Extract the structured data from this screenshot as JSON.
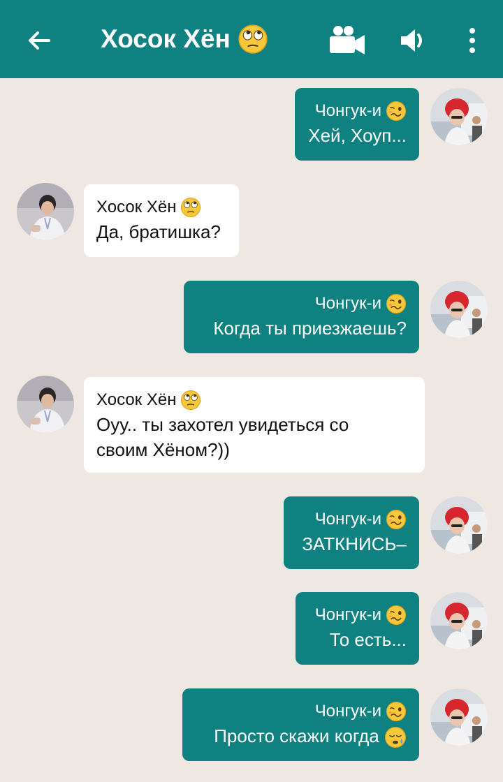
{
  "header": {
    "title": "Хосок Хён",
    "title_emoji": "eye-roll-emoji",
    "back_icon": "back-arrow-icon",
    "video_icon": "video-camera-icon",
    "sound_icon": "speaker-icon",
    "more_icon": "more-vert-icon"
  },
  "colors": {
    "header": "#0f8180",
    "outgoing_bubble": "#0f8180",
    "incoming_bubble": "#ffffff",
    "background": "#efe7e2"
  },
  "messages": [
    {
      "direction": "out",
      "sender": "Чонгук-и",
      "sender_emoji": "woozy-face-emoji",
      "text": "Хей, Хоуп..."
    },
    {
      "direction": "in",
      "sender": "Хосок Хён",
      "sender_emoji": "eye-roll-emoji",
      "text": "Да, братишка?"
    },
    {
      "direction": "out",
      "sender": "Чонгук-и",
      "sender_emoji": "woozy-face-emoji",
      "text": "Когда ты приезжаешь?"
    },
    {
      "direction": "in",
      "sender": "Хосок Хён",
      "sender_emoji": "eye-roll-emoji",
      "text": "Оуу.. ты захотел увидеться со своим Хёном?))"
    },
    {
      "direction": "out",
      "sender": "Чонгук-и",
      "sender_emoji": "woozy-face-emoji",
      "text": "ЗАТКНИСЬ–"
    },
    {
      "direction": "out",
      "sender": "Чонгук-и",
      "sender_emoji": "woozy-face-emoji",
      "text": "То есть..."
    },
    {
      "direction": "out",
      "sender": "Чонгук-и",
      "sender_emoji": "woozy-face-emoji",
      "text": "Просто скажи когда",
      "trailing_emoji": "sleepy-face-emoji"
    }
  ]
}
